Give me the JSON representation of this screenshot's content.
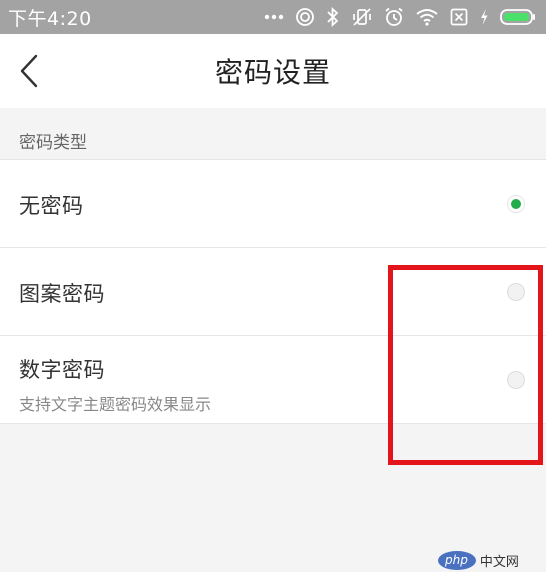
{
  "status_bar": {
    "time": "下午4:20",
    "icons": [
      "more-dots-icon",
      "hotspot-icon",
      "bluetooth-icon",
      "vibrate-off-icon",
      "alarm-icon",
      "wifi-icon",
      "sim-empty-icon",
      "charging-icon",
      "battery-icon"
    ]
  },
  "navbar": {
    "title": "密码设置"
  },
  "section": {
    "title": "密码类型"
  },
  "options": [
    {
      "label": "无密码",
      "selected": true
    },
    {
      "label": "图案密码",
      "selected": false
    },
    {
      "label": "数字密码",
      "subtitle": "支持文字主题密码效果显示",
      "selected": false
    }
  ],
  "watermark": {
    "badge": "php",
    "text": "中文网"
  },
  "colors": {
    "accent": "#22ad4a",
    "highlight": "#e4141b",
    "status_bar_bg": "#a3a3a3"
  }
}
